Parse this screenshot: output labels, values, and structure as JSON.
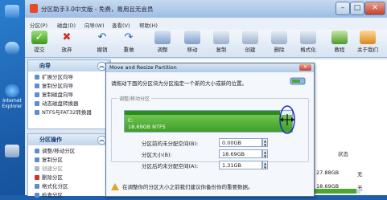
{
  "window": {
    "title": "分区助手3.0中文版 - 免费，易用且无会员"
  },
  "menubar": {
    "items": [
      "分区(P)",
      "磁盘(D)",
      "向导(W)",
      "查看(V)",
      "帮助(H)"
    ]
  },
  "toolbar": {
    "buttons": [
      {
        "label": "提交",
        "icon": "submit-icon"
      },
      {
        "label": "放弃",
        "icon": "discard-icon"
      },
      {
        "label": "撤销",
        "icon": "undo-icon"
      },
      {
        "label": "重做",
        "icon": "redo-icon"
      },
      {
        "label": "调整",
        "icon": "adjust-icon"
      },
      {
        "label": "移动",
        "icon": "move-icon"
      },
      {
        "label": "复制",
        "icon": "copy-icon"
      },
      {
        "label": "创建",
        "icon": "create-icon"
      },
      {
        "label": "删除",
        "icon": "delete-icon"
      },
      {
        "label": "格式化",
        "icon": "format-icon"
      },
      {
        "label": "教程",
        "icon": "tutorial-icon"
      },
      {
        "label": "关于我们",
        "icon": "about-icon"
      }
    ]
  },
  "desktop": {
    "icons": [
      "Internet",
      "Explorer"
    ]
  },
  "wizard_panel": {
    "title": "向导",
    "items": [
      "扩展分区向导",
      "复制分区向导",
      "复制磁盘向导",
      "动态磁盘转换器",
      "NTFS与FAT32转换器"
    ]
  },
  "partition_panel": {
    "title": "分区操作",
    "items": [
      "调整/移动分区",
      "复制分区",
      "创建分区",
      "删除分区",
      "格式化分区",
      "检查分区"
    ]
  },
  "list_tail": {
    "col": "状态",
    "rows": [
      [
        "27.88GB",
        "无"
      ],
      [
        "18.69GB",
        "无"
      ]
    ]
  },
  "dialog": {
    "title": "Move and Resize Partition",
    "instruction": "请拖动下面的分区块为分区指定一个新的大小或新的位置。",
    "group_label": "调整/移动分区",
    "partition_name": "C:",
    "partition_info": "18.69GB NTFS",
    "fields": [
      {
        "label": "分区前的未分配空间(B):",
        "value": "0.00GB"
      },
      {
        "label": "分区大小(B):",
        "value": "18.69GB"
      },
      {
        "label": "分区后的未分配空间(A):",
        "value": "1.31GB"
      }
    ],
    "warning": "在调整你的分区大小之前我们建议你备份你的重要数据。",
    "used_fraction": 0.93
  },
  "colors": {
    "accent": "#1f5fb3",
    "partition_green": "#4aa832",
    "annotation": "#1a2fb8"
  }
}
